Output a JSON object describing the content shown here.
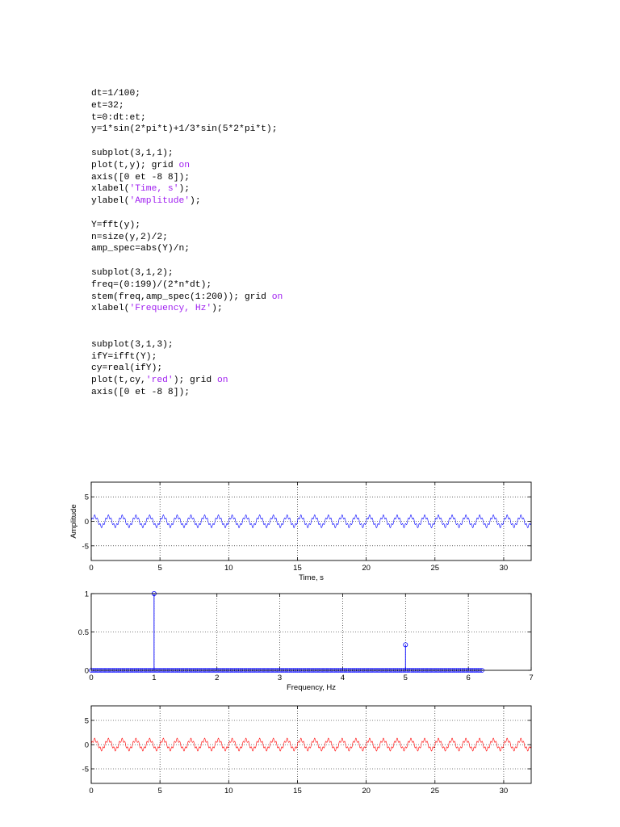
{
  "code_lines": [
    [
      {
        "t": "dt=1/100;"
      }
    ],
    [
      {
        "t": "et=32;"
      }
    ],
    [
      {
        "t": "t=0:dt:et;"
      }
    ],
    [
      {
        "t": "y=1*sin(2*pi*t)+1/3*sin(5*2*pi*t);"
      }
    ],
    [],
    [
      {
        "t": "subplot(3,1,1);"
      }
    ],
    [
      {
        "t": "plot(t,y); grid "
      },
      {
        "t": "on",
        "kw": true
      }
    ],
    [
      {
        "t": "axis([0 et -8 8]);"
      }
    ],
    [
      {
        "t": "xlabel("
      },
      {
        "t": "'Time, s'",
        "kw": true
      },
      {
        "t": ");"
      }
    ],
    [
      {
        "t": "ylabel("
      },
      {
        "t": "'Amplitude'",
        "kw": true
      },
      {
        "t": ");"
      }
    ],
    [],
    [
      {
        "t": "Y=fft(y);"
      }
    ],
    [
      {
        "t": "n=size(y,2)/2;"
      }
    ],
    [
      {
        "t": "amp_spec=abs(Y)/n;"
      }
    ],
    [],
    [
      {
        "t": "subplot(3,1,2);"
      }
    ],
    [
      {
        "t": "freq=(0:199)/(2*n*dt);"
      }
    ],
    [
      {
        "t": "stem(freq,amp_spec(1:200)); grid "
      },
      {
        "t": "on",
        "kw": true
      }
    ],
    [
      {
        "t": "xlabel("
      },
      {
        "t": "'Frequency, Hz'",
        "kw": true
      },
      {
        "t": ");"
      }
    ],
    [],
    [],
    [
      {
        "t": "subplot(3,1,3);"
      }
    ],
    [
      {
        "t": "ifY=ifft(Y);"
      }
    ],
    [
      {
        "t": "cy=real(ifY);"
      }
    ],
    [
      {
        "t": "plot(t,cy,"
      },
      {
        "t": "'red'",
        "kw": true
      },
      {
        "t": "); grid "
      },
      {
        "t": "on",
        "kw": true
      }
    ],
    [
      {
        "t": "axis([0 et -8 8]);"
      }
    ]
  ],
  "chart_data": [
    {
      "type": "line",
      "title": "",
      "xlabel": "Time, s",
      "ylabel": "Amplitude",
      "xlim": [
        0,
        32
      ],
      "ylim": [
        -8,
        8
      ],
      "xticks": [
        0,
        5,
        10,
        15,
        20,
        25,
        30
      ],
      "yticks": [
        -5,
        0,
        5
      ],
      "grid": true,
      "color": "#0000ff",
      "series": [
        {
          "function": "y=1*sin(2*pi*t)+1/3*sin(5*2*pi*t)",
          "dt": 0.01,
          "t_range": [
            0,
            32
          ]
        }
      ]
    },
    {
      "type": "stem",
      "title": "",
      "xlabel": "Frequency, Hz",
      "ylabel": "",
      "xlim": [
        0,
        7
      ],
      "ylim": [
        0,
        1
      ],
      "xticks": [
        0,
        1,
        2,
        3,
        4,
        5,
        6,
        7
      ],
      "yticks": [
        0,
        0.5,
        1
      ],
      "grid": true,
      "color": "#0000ff",
      "stems": [
        {
          "x": 1,
          "y": 1
        },
        {
          "x": 5,
          "y": 0.333
        }
      ],
      "freq_range": [
        0,
        6.22
      ],
      "freq_step": 0.03125
    },
    {
      "type": "line",
      "title": "",
      "xlabel": "",
      "ylabel": "",
      "xlim": [
        0,
        32
      ],
      "ylim": [
        -8,
        8
      ],
      "xticks": [
        0,
        5,
        10,
        15,
        20,
        25,
        30
      ],
      "yticks": [
        -5,
        0,
        5
      ],
      "grid": true,
      "color": "#ff0000",
      "series": [
        {
          "function": "real(ifft(fft(y)))",
          "dt": 0.01,
          "t_range": [
            0,
            32
          ]
        }
      ]
    }
  ]
}
